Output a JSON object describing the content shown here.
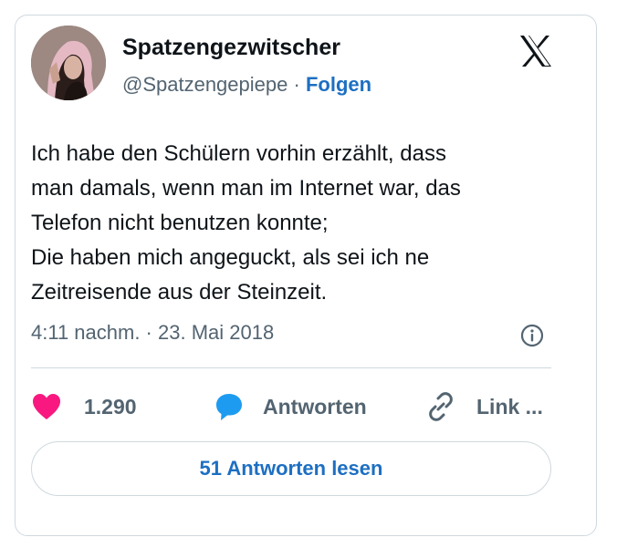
{
  "author": {
    "display_name": "Spatzengezwitscher",
    "handle": "@Spatzengepiepe",
    "separator": "·",
    "follow_label": "Folgen",
    "avatar_icon": "profile-photo"
  },
  "tweet": {
    "lines": [
      "Ich habe den Schülern vorhin erzählt, dass",
      "man damals, wenn man im Internet war, das",
      "Telefon nicht benutzen konnte;",
      "Die haben mich angeguckt, als sei ich ne",
      "Zeitreisende aus der Steinzeit."
    ],
    "timestamp": "4:11 nachm. · 23. Mai 2018"
  },
  "actions": {
    "likes": "1.290",
    "reply_label": "Antworten",
    "link_label": "Link ...",
    "like_icon": "heart-icon",
    "reply_icon": "speech-bubble-icon",
    "link_icon": "link-icon"
  },
  "read_replies_label": "51 Antworten lesen",
  "colors": {
    "accent": "#1d6fc2",
    "like": "#f91880",
    "reply": "#1d9bf0",
    "muted": "#536471",
    "border": "#cfd9de"
  }
}
